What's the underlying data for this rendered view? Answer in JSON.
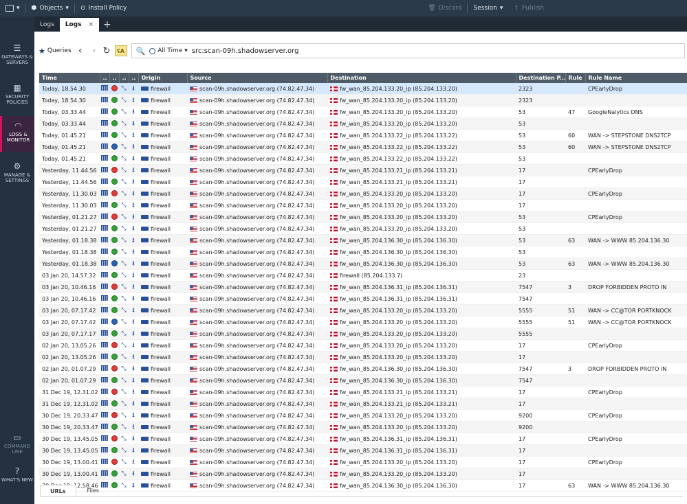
{
  "topbar": {
    "objects_label": "Objects",
    "install_policy_label": "Install Policy",
    "discard_label": "Discard",
    "session_label": "Session",
    "publish_label": "Publish"
  },
  "sidebar": {
    "gateways": "GATEWAYS & SERVERS",
    "security": "SECURITY POLICIES",
    "logs": "LOGS & MONITOR",
    "manage": "MANAGE & SETTINGS",
    "command": "COMMAND LINE",
    "whats_new": "WHAT'S NEW"
  },
  "tabs": [
    "Logs",
    "Logs"
  ],
  "toolbar": {
    "queries_label": "Queries",
    "time_filter": "All Time",
    "query": "src:scan-09h.shadowserver.org"
  },
  "table": {
    "columns": [
      "Time",
      "..",
      "..",
      "..",
      "..",
      "Origin",
      "Source",
      "Destination",
      "Destination P...",
      "Rule",
      "Rule Name"
    ],
    "rows": [
      {
        "time": "Today, 18.54.30",
        "action": "drop",
        "origin": "firewall",
        "src": "scan-09h.shadowserver.org (74.82.47.34)",
        "dst": "fw_wan_85.204.133.20_ip (85.204.133.20)",
        "port": "2323",
        "rule": "",
        "rule_name": "CPEarlyDrop"
      },
      {
        "time": "Today, 18.54.30",
        "action": "accept",
        "origin": "firewall",
        "src": "scan-09h.shadowserver.org (74.82.47.34)",
        "dst": "fw_wan_85.204.133.20_ip (85.204.133.20)",
        "port": "2323",
        "rule": "",
        "rule_name": ""
      },
      {
        "time": "Today, 03.33.44",
        "action": "accept",
        "origin": "firewall",
        "src": "scan-09h.shadowserver.org (74.82.47.34)",
        "dst": "fw_wan_85.204.133.20_ip (85.204.133.20)",
        "port": "53",
        "rule": "47",
        "rule_name": "GoogleNalytics DNS"
      },
      {
        "time": "Today, 03.33.44",
        "action": "accept",
        "origin": "firewall",
        "src": "scan-09h.shadowserver.org (74.82.47.34)",
        "dst": "fw_wan_85.204.133.20_ip (85.204.133.20)",
        "port": "53",
        "rule": "",
        "rule_name": ""
      },
      {
        "time": "Today, 01.45.21",
        "action": "accept",
        "origin": "firewall",
        "src": "scan-09h.shadowserver.org (74.82.47.34)",
        "dst": "fw_wan_85.204.133.22_ip (85.204.133.22)",
        "port": "53",
        "rule": "60",
        "rule_name": "WAN -> STEPSTONE DNS2TCP"
      },
      {
        "time": "Today, 01.45.21",
        "action": "blue",
        "origin": "firewall",
        "src": "scan-09h.shadowserver.org (74.82.47.34)",
        "dst": "fw_wan_85.204.133.22_ip (85.204.133.22)",
        "port": "53",
        "rule": "60",
        "rule_name": "WAN -> STEPSTONE DNS2TCP"
      },
      {
        "time": "Today, 01.45.21",
        "action": "accept",
        "origin": "firewall",
        "src": "scan-09h.shadowserver.org (74.82.47.34)",
        "dst": "fw_wan_85.204.133.22_ip (85.204.133.22)",
        "port": "53",
        "rule": "",
        "rule_name": ""
      },
      {
        "time": "Yesterday, 11.44.56",
        "action": "drop",
        "origin": "firewall",
        "src": "scan-09h.shadowserver.org (74.82.47.34)",
        "dst": "fw_wan_85.204.133.21_ip (85.204.133.21)",
        "port": "17",
        "rule": "",
        "rule_name": "CPEarlyDrop"
      },
      {
        "time": "Yesterday, 11.44.56",
        "action": "accept",
        "origin": "firewall",
        "src": "scan-09h.shadowserver.org (74.82.47.34)",
        "dst": "fw_wan_85.204.133.21_ip (85.204.133.21)",
        "port": "17",
        "rule": "",
        "rule_name": ""
      },
      {
        "time": "Yesterday, 11.30.03",
        "action": "drop",
        "origin": "firewall",
        "src": "scan-09h.shadowserver.org (74.82.47.34)",
        "dst": "fw_wan_85.204.133.20_ip (85.204.133.20)",
        "port": "17",
        "rule": "",
        "rule_name": "CPEarlyDrop"
      },
      {
        "time": "Yesterday, 11.30.03",
        "action": "accept",
        "origin": "firewall",
        "src": "scan-09h.shadowserver.org (74.82.47.34)",
        "dst": "fw_wan_85.204.133.20_ip (85.204.133.20)",
        "port": "17",
        "rule": "",
        "rule_name": ""
      },
      {
        "time": "Yesterday, 01.21.27",
        "action": "drop",
        "origin": "firewall",
        "src": "scan-09h.shadowserver.org (74.82.47.34)",
        "dst": "fw_wan_85.204.133.20_ip (85.204.133.20)",
        "port": "53",
        "rule": "",
        "rule_name": "CPEarlyDrop"
      },
      {
        "time": "Yesterday, 01.21.27",
        "action": "accept",
        "origin": "firewall",
        "src": "scan-09h.shadowserver.org (74.82.47.34)",
        "dst": "fw_wan_85.204.133.20_ip (85.204.133.20)",
        "port": "53",
        "rule": "",
        "rule_name": ""
      },
      {
        "time": "Yesterday, 01.18.38",
        "action": "accept",
        "origin": "firewall",
        "src": "scan-09h.shadowserver.org (74.82.47.34)",
        "dst": "fw_wan_85.204.136.30_ip (85.204.136.30)",
        "port": "53",
        "rule": "63",
        "rule_name": "WAN -> WWW 85.204.136.30"
      },
      {
        "time": "Yesterday, 01.18.38",
        "action": "accept",
        "origin": "firewall",
        "src": "scan-09h.shadowserver.org (74.82.47.34)",
        "dst": "fw_wan_85.204.136.30_ip (85.204.136.30)",
        "port": "53",
        "rule": "",
        "rule_name": ""
      },
      {
        "time": "Yesterday, 01.18.38",
        "action": "blue",
        "origin": "firewall",
        "src": "scan-09h.shadowserver.org (74.82.47.34)",
        "dst": "fw_wan_85.204.136.30_ip (85.204.136.30)",
        "port": "53",
        "rule": "63",
        "rule_name": "WAN -> WWW 85.204.136.30"
      },
      {
        "time": "03 Jan 20, 14.57.32",
        "action": "accept",
        "origin": "firewall",
        "src": "scan-09h.shadowserver.org (74.82.47.34)",
        "dst": "firewall (85.204.133.7)",
        "port": "23",
        "rule": "",
        "rule_name": ""
      },
      {
        "time": "03 Jan 20, 10.46.16",
        "action": "drop",
        "origin": "firewall",
        "src": "scan-09h.shadowserver.org (74.82.47.34)",
        "dst": "fw_wan_85.204.136.31_ip (85.204.136.31)",
        "port": "7547",
        "rule": "3",
        "rule_name": "DROP FORBIDDEN PROTO IN"
      },
      {
        "time": "03 Jan 20, 10.46.16",
        "action": "accept",
        "origin": "firewall",
        "src": "scan-09h.shadowserver.org (74.82.47.34)",
        "dst": "fw_wan_85.204.136.31_ip (85.204.136.31)",
        "port": "7547",
        "rule": "",
        "rule_name": ""
      },
      {
        "time": "03 Jan 20, 07.17.42",
        "action": "accept",
        "origin": "firewall",
        "src": "scan-09h.shadowserver.org (74.82.47.34)",
        "dst": "fw_wan_85.204.133.20_ip (85.204.133.20)",
        "port": "5555",
        "rule": "51",
        "rule_name": "WAN -> CC@TOR PORTKNOCK"
      },
      {
        "time": "03 Jan 20, 07.17.42",
        "action": "blue",
        "origin": "firewall",
        "src": "scan-09h.shadowserver.org (74.82.47.34)",
        "dst": "fw_wan_85.204.133.20_ip (85.204.133.20)",
        "port": "5555",
        "rule": "51",
        "rule_name": "WAN -> CC@TOR PORTKNOCK"
      },
      {
        "time": "03 Jan 20, 07.17.17",
        "action": "accept",
        "origin": "firewall",
        "src": "scan-09h.shadowserver.org (74.82.47.34)",
        "dst": "fw_wan_85.204.133.20_ip (85.204.133.20)",
        "port": "5555",
        "rule": "",
        "rule_name": ""
      },
      {
        "time": "02 Jan 20, 13.05.26",
        "action": "drop",
        "origin": "firewall",
        "src": "scan-09h.shadowserver.org (74.82.47.34)",
        "dst": "fw_wan_85.204.133.20_ip (85.204.133.20)",
        "port": "17",
        "rule": "",
        "rule_name": "CPEarlyDrop"
      },
      {
        "time": "02 Jan 20, 13.05.26",
        "action": "accept",
        "origin": "firewall",
        "src": "scan-09h.shadowserver.org (74.82.47.34)",
        "dst": "fw_wan_85.204.133.20_ip (85.204.133.20)",
        "port": "17",
        "rule": "",
        "rule_name": ""
      },
      {
        "time": "02 Jan 20, 01.07.29",
        "action": "drop",
        "origin": "firewall",
        "src": "scan-09h.shadowserver.org (74.82.47.34)",
        "dst": "fw_wan_85.204.136.30_ip (85.204.136.30)",
        "port": "7547",
        "rule": "3",
        "rule_name": "DROP FORBIDDEN PROTO IN"
      },
      {
        "time": "02 Jan 20, 01.07.29",
        "action": "accept",
        "origin": "firewall",
        "src": "scan-09h.shadowserver.org (74.82.47.34)",
        "dst": "fw_wan_85.204.136.30_ip (85.204.136.30)",
        "port": "7547",
        "rule": "",
        "rule_name": ""
      },
      {
        "time": "31 Dec 19, 12.31.02",
        "action": "drop",
        "origin": "firewall",
        "src": "scan-09h.shadowserver.org (74.82.47.34)",
        "dst": "fw_wan_85.204.133.21_ip (85.204.133.21)",
        "port": "17",
        "rule": "",
        "rule_name": "CPEarlyDrop"
      },
      {
        "time": "31 Dec 19, 12.31.02",
        "action": "accept",
        "origin": "firewall",
        "src": "scan-09h.shadowserver.org (74.82.47.34)",
        "dst": "fw_wan_85.204.133.21_ip (85.204.133.21)",
        "port": "17",
        "rule": "",
        "rule_name": ""
      },
      {
        "time": "30 Dec 19, 20.33.47",
        "action": "drop",
        "origin": "firewall",
        "src": "scan-09h.shadowserver.org (74.82.47.34)",
        "dst": "fw_wan_85.204.133.20_ip (85.204.133.20)",
        "port": "9200",
        "rule": "",
        "rule_name": "CPEarlyDrop"
      },
      {
        "time": "30 Dec 19, 20.33.47",
        "action": "accept",
        "origin": "firewall",
        "src": "scan-09h.shadowserver.org (74.82.47.34)",
        "dst": "fw_wan_85.204.133.20_ip (85.204.133.20)",
        "port": "9200",
        "rule": "",
        "rule_name": ""
      },
      {
        "time": "30 Dec 19, 13.45.05",
        "action": "drop",
        "origin": "firewall",
        "src": "scan-09h.shadowserver.org (74.82.47.34)",
        "dst": "fw_wan_85.204.136.31_ip (85.204.136.31)",
        "port": "17",
        "rule": "",
        "rule_name": "CPEarlyDrop"
      },
      {
        "time": "30 Dec 19, 13.45.05",
        "action": "accept",
        "origin": "firewall",
        "src": "scan-09h.shadowserver.org (74.82.47.34)",
        "dst": "fw_wan_85.204.136.31_ip (85.204.136.31)",
        "port": "17",
        "rule": "",
        "rule_name": ""
      },
      {
        "time": "30 Dec 19, 13.00.41",
        "action": "drop",
        "origin": "firewall",
        "src": "scan-09h.shadowserver.org (74.82.47.34)",
        "dst": "fw_wan_85.204.133.20_ip (85.204.133.20)",
        "port": "17",
        "rule": "",
        "rule_name": "CPEarlyDrop"
      },
      {
        "time": "30 Dec 19, 13.00.41",
        "action": "accept",
        "origin": "firewall",
        "src": "scan-09h.shadowserver.org (74.82.47.34)",
        "dst": "fw_wan_85.204.133.20_ip (85.204.133.20)",
        "port": "17",
        "rule": "",
        "rule_name": ""
      },
      {
        "time": "30 Dec 19, 12.58.46",
        "action": "accept",
        "origin": "firewall",
        "src": "scan-09h.shadowserver.org (74.82.47.34)",
        "dst": "fw_wan_85.204.136.30_ip (85.204.136.30)",
        "port": "17",
        "rule": "63",
        "rule_name": "WAN -> WWW 85.204.136.30"
      }
    ]
  },
  "bottom_tabs": [
    "URLs",
    "Files"
  ],
  "colors": {
    "drop": "#e23b3b",
    "accept": "#35a23b",
    "blue": "#2b63b8",
    "header": "#4f5b66",
    "selected": "#d6e8fb"
  }
}
